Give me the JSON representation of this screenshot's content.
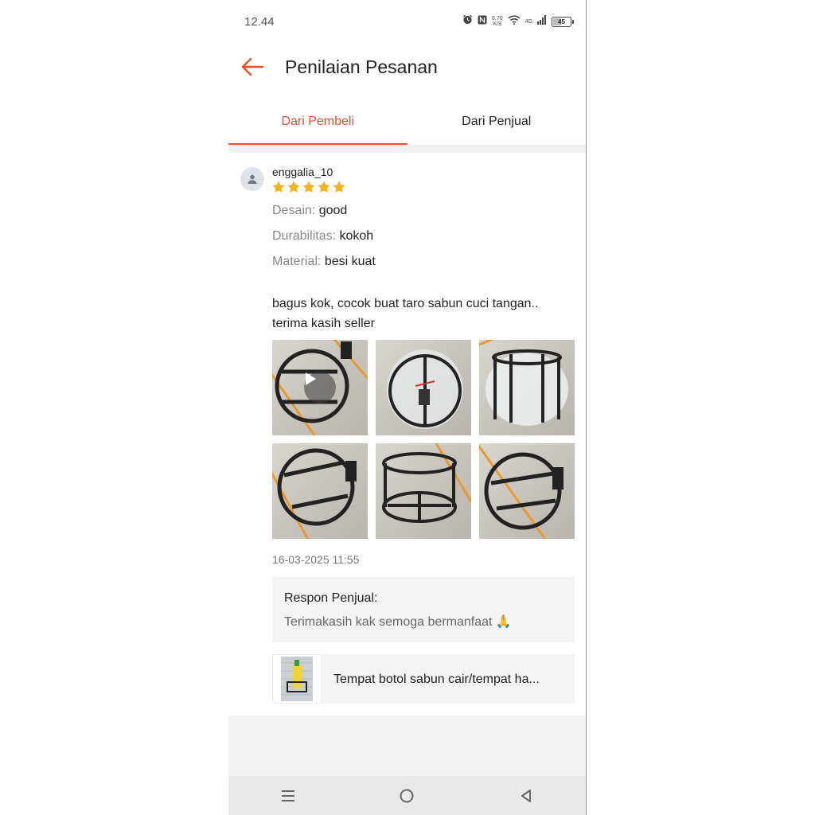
{
  "status_bar": {
    "time": "12.44",
    "net_speed_value": "6,70",
    "net_speed_unit": "K/S",
    "network_type": "4G",
    "battery": "45"
  },
  "header": {
    "title": "Penilaian Pesanan"
  },
  "tabs": [
    {
      "label": "Dari Pembeli",
      "active": true
    },
    {
      "label": "Dari Penjual",
      "active": false
    }
  ],
  "review": {
    "username": "enggalia_10",
    "rating": 5,
    "attributes": [
      {
        "key": "Desain:",
        "value": "good"
      },
      {
        "key": "Durabilitas:",
        "value": "kokoh"
      },
      {
        "key": "Material:",
        "value": "besi kuat"
      }
    ],
    "comment": "bagus kok, cocok buat taro sabun cuci tangan.. terima kasih seller",
    "photos_count": 6,
    "date": "16-03-2025 11:55",
    "seller_response": {
      "title": "Respon Penjual:",
      "text": "Terimakasih kak semoga bermanfaat 🙏"
    },
    "product": {
      "name": "Tempat botol sabun cair/tempat ha..."
    }
  },
  "colors": {
    "accent": "#ee4d2d",
    "star": "#f6b21a"
  }
}
